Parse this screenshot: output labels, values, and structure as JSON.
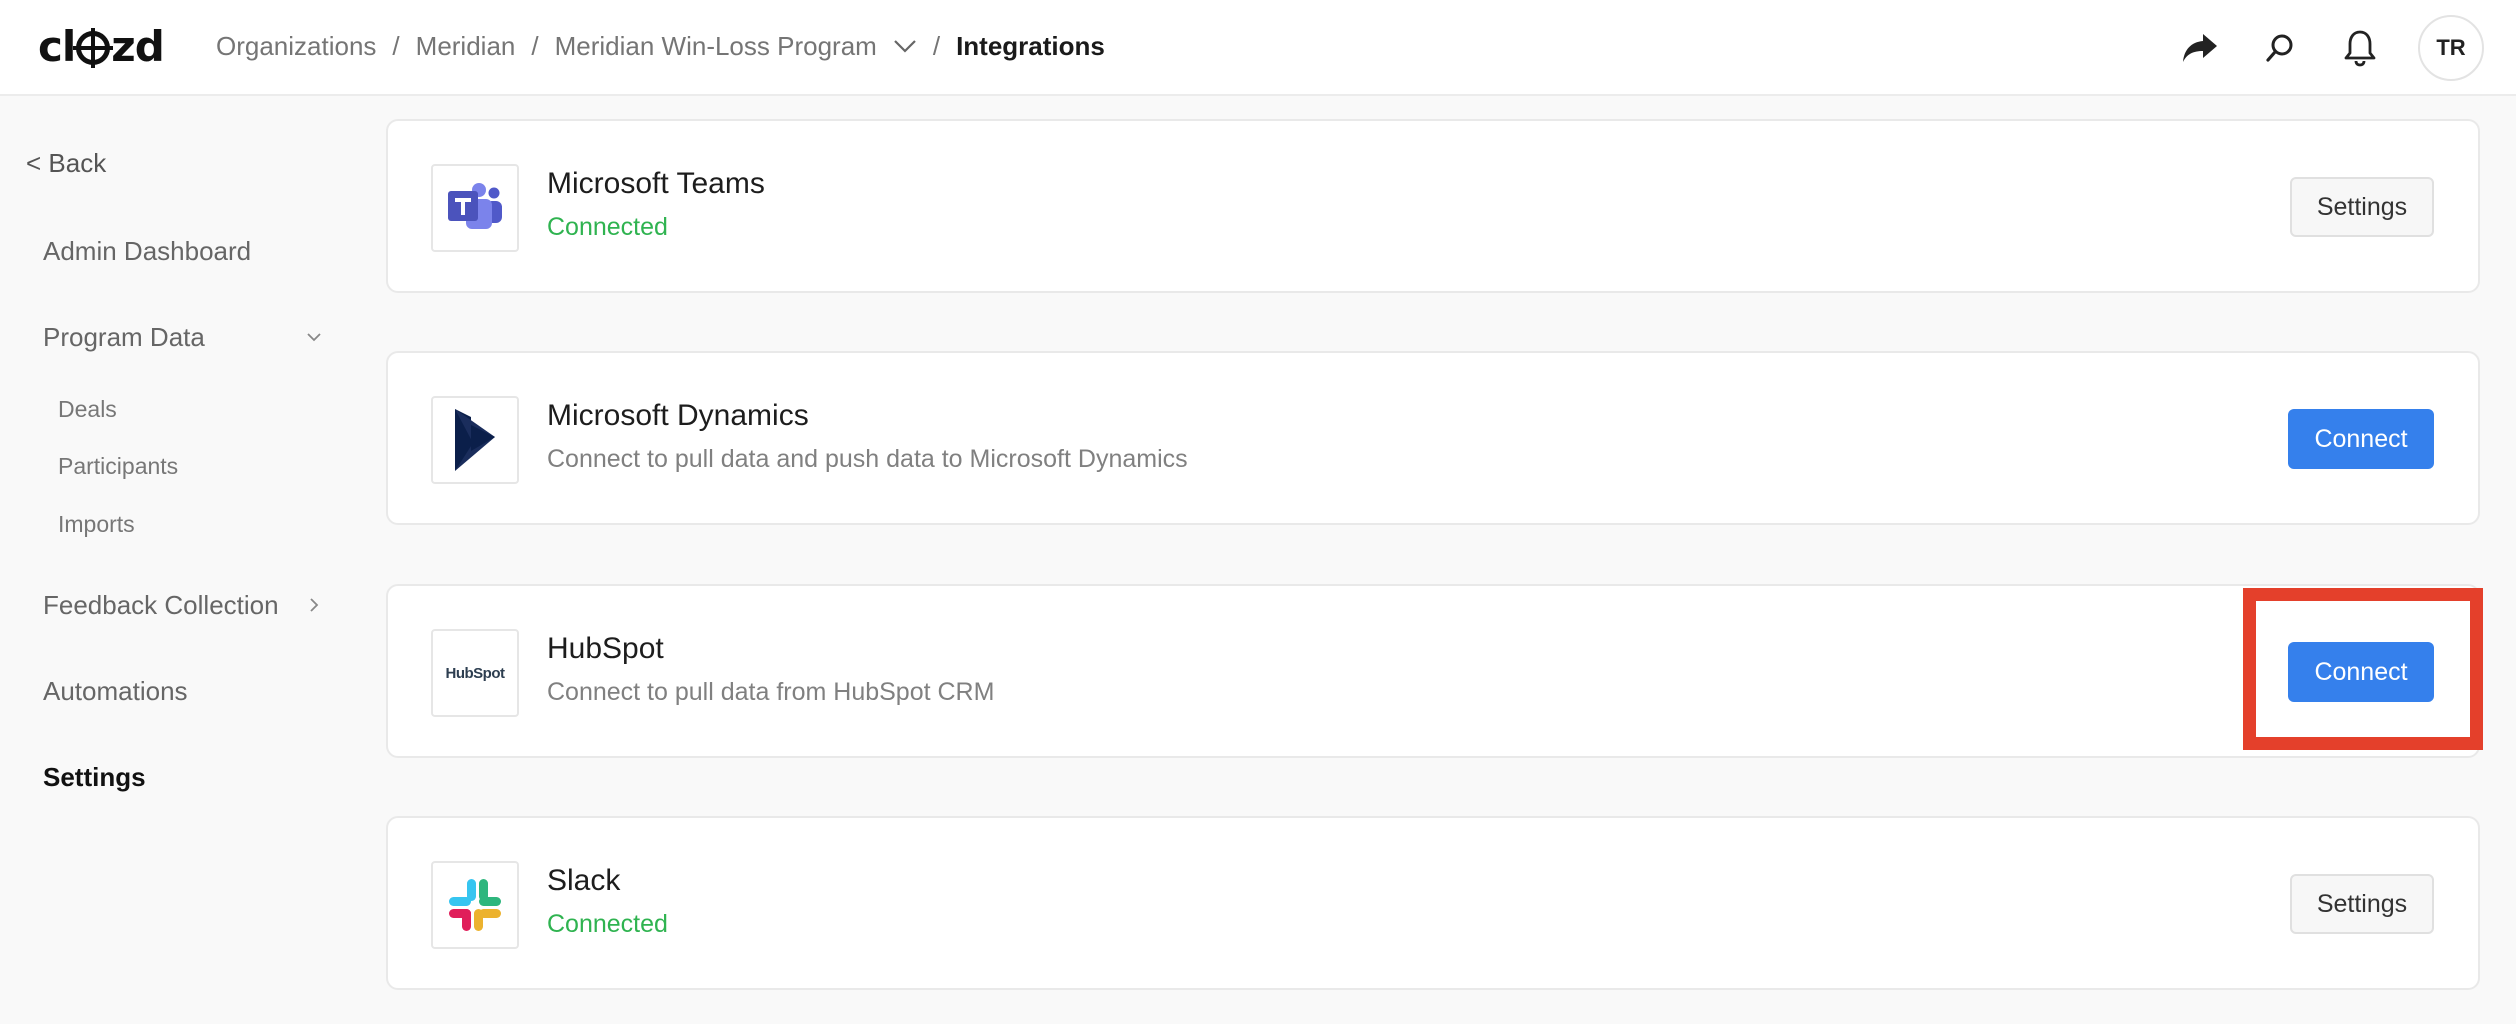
{
  "header": {
    "logo_text": "clozd",
    "breadcrumb": {
      "items": [
        "Organizations",
        "Meridian",
        "Meridian Win-Loss Program"
      ],
      "current": "Integrations",
      "separator": "/"
    },
    "icons": [
      "share-icon",
      "search-icon",
      "bell-icon"
    ],
    "avatar_initials": "TR"
  },
  "sidebar": {
    "back": "< Back",
    "items": [
      {
        "label": "Admin Dashboard"
      },
      {
        "label": "Program Data"
      },
      {
        "label": "Deals"
      },
      {
        "label": "Participants"
      },
      {
        "label": "Imports"
      },
      {
        "label": "Feedback Collection"
      },
      {
        "label": "Automations"
      },
      {
        "label": "Settings"
      }
    ]
  },
  "integrations": [
    {
      "name": "Microsoft Teams",
      "status": "Connected",
      "action": "Settings",
      "icon": "teams-icon"
    },
    {
      "name": "Microsoft Dynamics",
      "status": "Connect to pull data and push data to Microsoft Dynamics",
      "action": "Connect",
      "icon": "dynamics-icon"
    },
    {
      "name": "HubSpot",
      "status": "Connect to pull data from HubSpot CRM",
      "action": "Connect",
      "icon": "hubspot-icon",
      "logo_text": "HubSpot"
    },
    {
      "name": "Slack",
      "status": "Connected",
      "action": "Settings",
      "icon": "slack-icon"
    }
  ],
  "colors": {
    "primary": "#3580ec",
    "connected": "#2fb350",
    "highlight": "#e4402b"
  }
}
